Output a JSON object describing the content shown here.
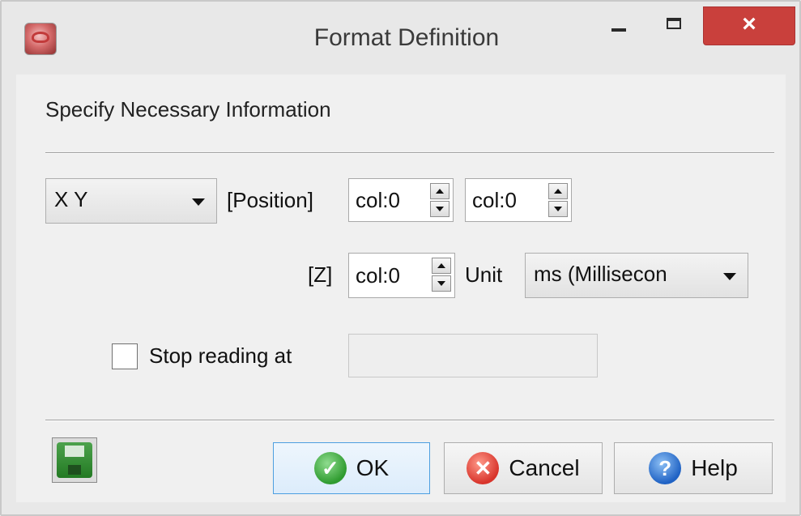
{
  "window": {
    "title": "Format Definition",
    "close_glyph": "×"
  },
  "section": {
    "label": "Specify Necessary Information"
  },
  "format_select": {
    "value": "X Y"
  },
  "position": {
    "label": "[Position]",
    "x_value": "col:0",
    "y_value": "col:0"
  },
  "z": {
    "label": "[Z]",
    "value": "col:0"
  },
  "unit": {
    "label": "Unit",
    "value": "ms (Millisecon"
  },
  "stop_reading": {
    "label": "Stop reading at",
    "checked": false,
    "value": ""
  },
  "buttons": {
    "ok": "OK",
    "cancel": "Cancel",
    "help": "Help"
  },
  "icons": {
    "app": "app-icon",
    "save": "floppy-disk-icon",
    "ok": "check-icon",
    "cancel": "x-icon",
    "help": "question-icon"
  },
  "colors": {
    "close_button": "#c9403c",
    "ok_border": "#4d9fe0",
    "save_icon": "#2f8f2f"
  }
}
